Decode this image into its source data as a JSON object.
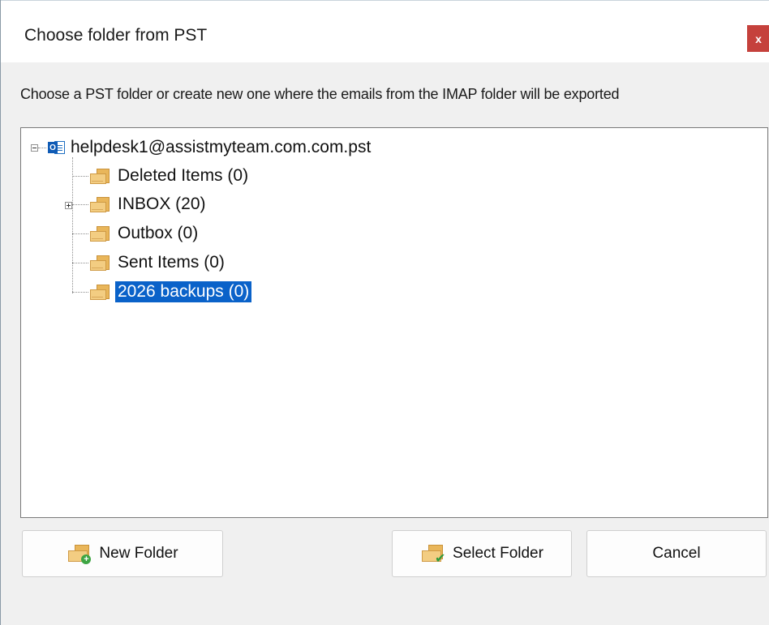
{
  "window": {
    "title": "Choose folder from PST",
    "close_label": "x"
  },
  "instruction": "Choose a PST folder or create new one where the emails from the IMAP folder will be exported",
  "tree": {
    "root": {
      "label": "helpdesk1@assistmyteam.com.com.pst",
      "icon": "outlook-pst-icon",
      "expanded": true
    },
    "items": [
      {
        "label": "Deleted Items (0)",
        "icon": "mail-folder-icon",
        "selected": false,
        "expandable": false
      },
      {
        "label": "INBOX (20)",
        "icon": "mail-folder-icon",
        "selected": false,
        "expandable": true
      },
      {
        "label": "Outbox (0)",
        "icon": "mail-folder-icon",
        "selected": false,
        "expandable": false
      },
      {
        "label": "Sent Items (0)",
        "icon": "mail-folder-icon",
        "selected": false,
        "expandable": false
      },
      {
        "label": "2026 backups (0)",
        "icon": "mail-folder-icon",
        "selected": true,
        "expandable": false
      }
    ]
  },
  "buttons": {
    "new_folder": "New Folder",
    "select_folder": "Select Folder",
    "cancel": "Cancel"
  },
  "colors": {
    "selection": "#0a62c9",
    "close": "#c5413c",
    "folder": "#e9b65a"
  }
}
